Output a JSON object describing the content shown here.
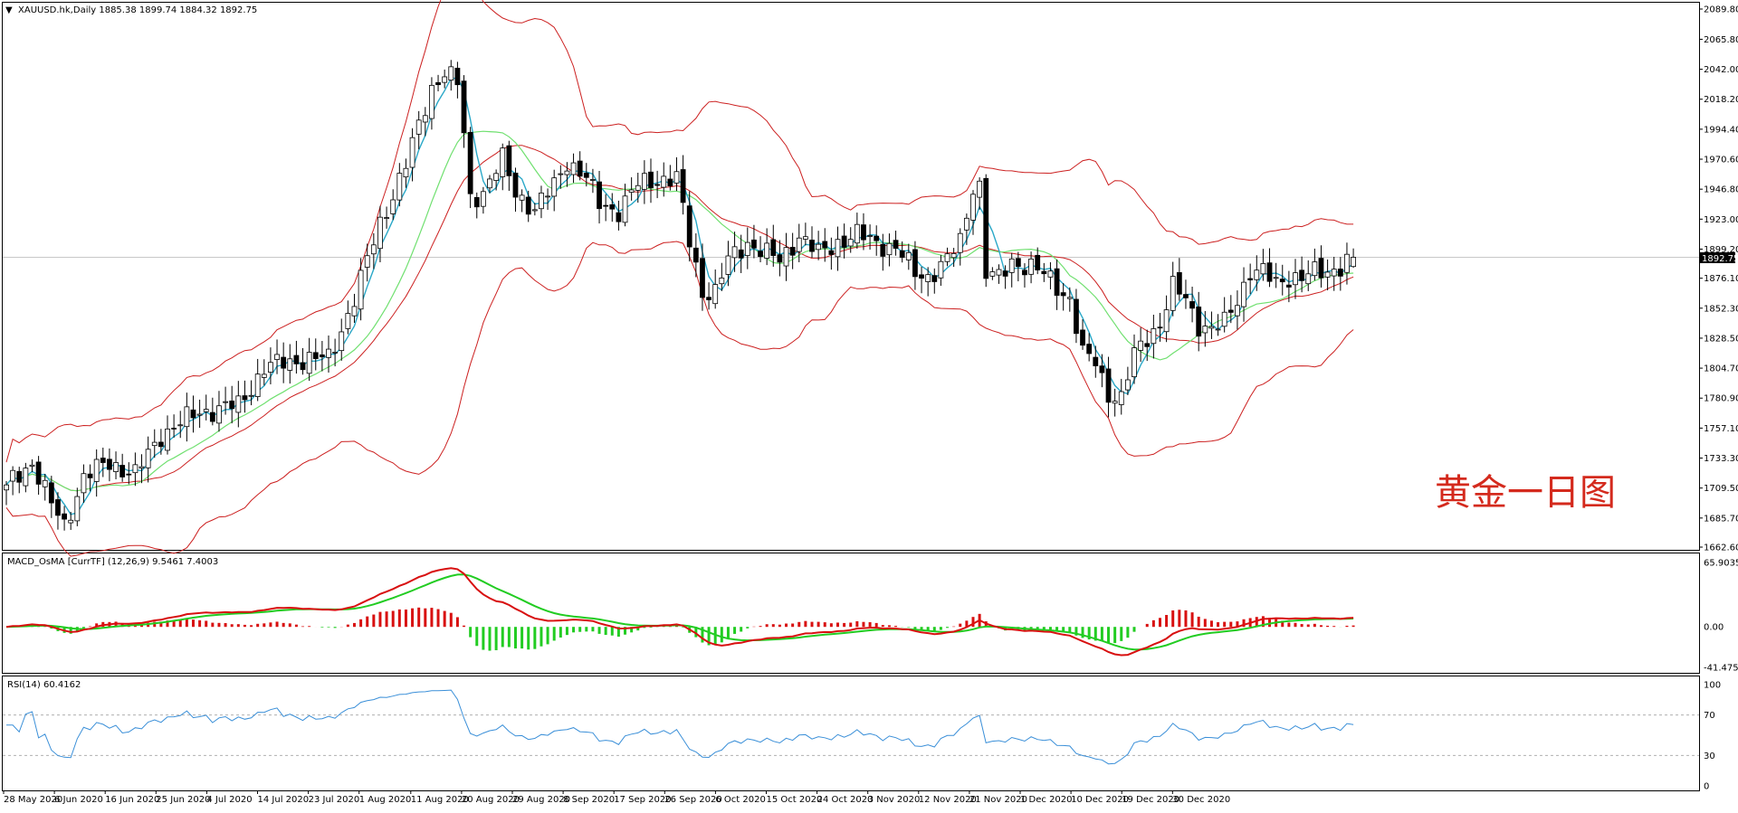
{
  "chart_data": [
    {
      "type": "candlestick",
      "panel": "price",
      "header": "XAUUSD.hk,Daily  1885.38 1899.74 1884.32 1892.75",
      "symbol": "XAUUSD.hk",
      "timeframe": "Daily",
      "ohlc_last": {
        "open": 1885.38,
        "high": 1899.74,
        "low": 1884.32,
        "close": 1892.75
      },
      "current_price_label": "1892.75",
      "watermark": "黄金一日图",
      "ylim": [
        1662.6,
        2089.8
      ],
      "y_ticks": [
        "2089.80",
        "2065.80",
        "2042.00",
        "2018.20",
        "1994.40",
        "1970.60",
        "1946.80",
        "1923.00",
        "1899.20",
        "1876.10",
        "1852.30",
        "1828.50",
        "1804.70",
        "1780.90",
        "1757.10",
        "1733.30",
        "1709.50",
        "1685.70",
        "1662.60"
      ],
      "x_ticks": [
        "28 May 2020",
        "6 Jun 2020",
        "16 Jun 2020",
        "25 Jun 2020",
        "4 Jul 2020",
        "14 Jul 2020",
        "23 Jul 2020",
        "1 Aug 2020",
        "11 Aug 2020",
        "20 Aug 2020",
        "29 Aug 2020",
        "8 Sep 2020",
        "17 Sep 2020",
        "26 Sep 2020",
        "6 Oct 2020",
        "15 Oct 2020",
        "24 Oct 2020",
        "3 Nov 2020",
        "12 Nov 2020",
        "21 Nov 2020",
        "1 Dec 2020",
        "10 Dec 2020",
        "19 Dec 2020",
        "30 Dec 2020"
      ],
      "close_keypoints": [
        {
          "i": 0,
          "v": 1712
        },
        {
          "i": 4,
          "v": 1730
        },
        {
          "i": 7,
          "v": 1696
        },
        {
          "i": 9,
          "v": 1680
        },
        {
          "i": 12,
          "v": 1718
        },
        {
          "i": 16,
          "v": 1730
        },
        {
          "i": 20,
          "v": 1720
        },
        {
          "i": 24,
          "v": 1752
        },
        {
          "i": 30,
          "v": 1770
        },
        {
          "i": 36,
          "v": 1775
        },
        {
          "i": 40,
          "v": 1805
        },
        {
          "i": 46,
          "v": 1812
        },
        {
          "i": 50,
          "v": 1812
        },
        {
          "i": 54,
          "v": 1860
        },
        {
          "i": 58,
          "v": 1920
        },
        {
          "i": 62,
          "v": 1966
        },
        {
          "i": 66,
          "v": 2028
        },
        {
          "i": 68,
          "v": 2040
        },
        {
          "i": 70,
          "v": 2030
        },
        {
          "i": 71,
          "v": 1990
        },
        {
          "i": 72,
          "v": 1940
        },
        {
          "i": 74,
          "v": 1945
        },
        {
          "i": 77,
          "v": 1970
        },
        {
          "i": 79,
          "v": 1945
        },
        {
          "i": 82,
          "v": 1930
        },
        {
          "i": 85,
          "v": 1950
        },
        {
          "i": 87,
          "v": 1970
        },
        {
          "i": 90,
          "v": 1955
        },
        {
          "i": 92,
          "v": 1935
        },
        {
          "i": 95,
          "v": 1930
        },
        {
          "i": 98,
          "v": 1950
        },
        {
          "i": 101,
          "v": 1955
        },
        {
          "i": 104,
          "v": 1955
        },
        {
          "i": 106,
          "v": 1905
        },
        {
          "i": 108,
          "v": 1866
        },
        {
          "i": 110,
          "v": 1865
        },
        {
          "i": 112,
          "v": 1890
        },
        {
          "i": 115,
          "v": 1905
        },
        {
          "i": 118,
          "v": 1895
        },
        {
          "i": 120,
          "v": 1890
        },
        {
          "i": 123,
          "v": 1910
        },
        {
          "i": 126,
          "v": 1895
        },
        {
          "i": 129,
          "v": 1905
        },
        {
          "i": 132,
          "v": 1910
        },
        {
          "i": 135,
          "v": 1905
        },
        {
          "i": 138,
          "v": 1900
        },
        {
          "i": 141,
          "v": 1880
        },
        {
          "i": 143,
          "v": 1878
        },
        {
          "i": 146,
          "v": 1890
        },
        {
          "i": 148,
          "v": 1905
        },
        {
          "i": 150,
          "v": 1950
        },
        {
          "i": 151,
          "v": 1950
        },
        {
          "i": 152,
          "v": 1880
        },
        {
          "i": 154,
          "v": 1875
        },
        {
          "i": 156,
          "v": 1890
        },
        {
          "i": 159,
          "v": 1885
        },
        {
          "i": 162,
          "v": 1875
        },
        {
          "i": 165,
          "v": 1860
        },
        {
          "i": 167,
          "v": 1815
        },
        {
          "i": 169,
          "v": 1810
        },
        {
          "i": 171,
          "v": 1785
        },
        {
          "i": 173,
          "v": 1780
        },
        {
          "i": 175,
          "v": 1815
        },
        {
          "i": 177,
          "v": 1830
        },
        {
          "i": 179,
          "v": 1840
        },
        {
          "i": 181,
          "v": 1868
        },
        {
          "i": 183,
          "v": 1860
        },
        {
          "i": 185,
          "v": 1840
        },
        {
          "i": 187,
          "v": 1835
        },
        {
          "i": 189,
          "v": 1840
        },
        {
          "i": 191,
          "v": 1860
        },
        {
          "i": 193,
          "v": 1882
        },
        {
          "i": 195,
          "v": 1880
        },
        {
          "i": 197,
          "v": 1872
        },
        {
          "i": 199,
          "v": 1878
        },
        {
          "i": 201,
          "v": 1876
        },
        {
          "i": 203,
          "v": 1880
        },
        {
          "i": 205,
          "v": 1882
        },
        {
          "i": 207,
          "v": 1886
        },
        {
          "i": 209,
          "v": 1892.75
        }
      ]
    },
    {
      "type": "histogram+lines",
      "panel": "macd",
      "header": "MACD_OsMA [CurrTF] (12,26,9) 9.5461 7.4003",
      "name": "MACD_OsMA [CurrTF]",
      "params": [
        12,
        26,
        9
      ],
      "values": {
        "macd": 9.5461,
        "signal": 7.4003
      },
      "y_ticks": [
        "65.9035",
        "0.00",
        "-41.475"
      ],
      "ylim": [
        -41.475,
        65.9035
      ]
    },
    {
      "type": "line",
      "panel": "rsi",
      "header": "RSI(14) 60.4162",
      "name": "RSI(14)",
      "value": 60.4162,
      "levels": [
        70,
        30
      ],
      "y_ticks": [
        "100",
        "70",
        "30",
        "0"
      ],
      "ylim": [
        0,
        100
      ]
    }
  ],
  "colors": {
    "candle_bull_fill": "#ffffff",
    "candle_bear_fill": "#000000",
    "candle_outline": "#000000",
    "bollinger": "#cc2020",
    "ma_fast": "#2aa8c8",
    "ma_slow": "#70e070",
    "macd_line": "#d81010",
    "signal_line": "#22cc22",
    "hist_positive": "#d81010",
    "hist_negative": "#22cc22",
    "rsi_line": "#3a8fd8",
    "grid_level": "#b0b0b0",
    "price_label_bg": "#000000",
    "price_label_fg": "#ffffff"
  }
}
